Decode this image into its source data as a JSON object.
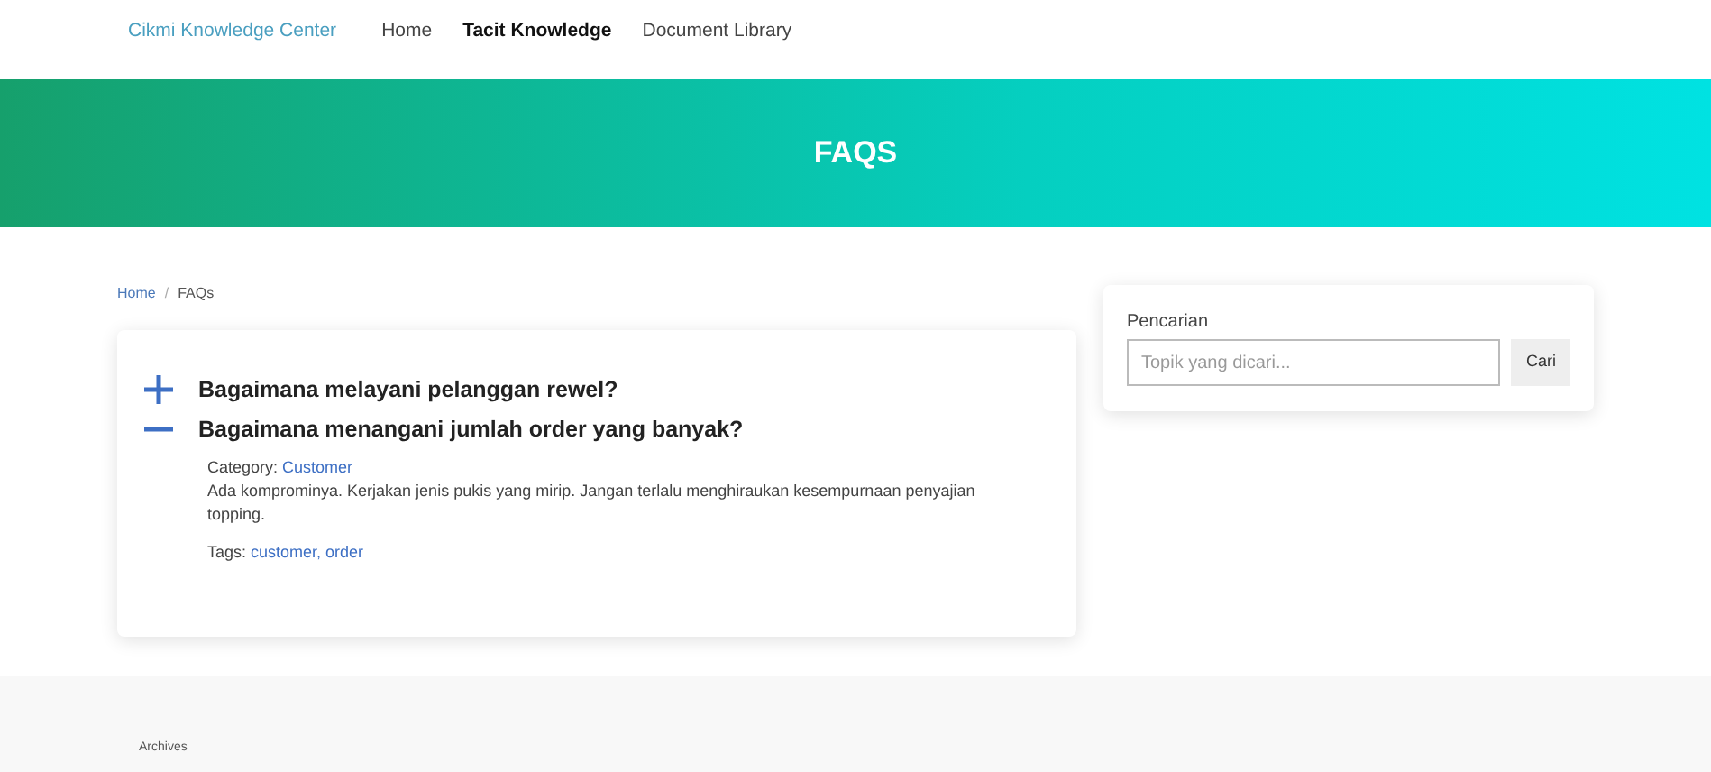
{
  "nav": {
    "brand": "Cikmi Knowledge Center",
    "links": [
      {
        "label": "Home",
        "selected": false
      },
      {
        "label": "Tacit Knowledge",
        "selected": true
      },
      {
        "label": "Document Library",
        "selected": false
      }
    ]
  },
  "hero": {
    "title": "FAQS"
  },
  "breadcrumb": [
    {
      "label": "Home",
      "kind": "link"
    },
    {
      "label": "/",
      "kind": "separator"
    },
    {
      "label": "FAQs",
      "kind": "current"
    }
  ],
  "faqs": [
    {
      "question": "Bagaimana melayani pelanggan rewel?",
      "expanded": false
    },
    {
      "question": "Bagaimana menangani jumlah order yang banyak?",
      "expanded": true,
      "category_label": "Category:",
      "category": "Customer",
      "answer": "Ada komprominya. Kerjakan jenis pukis yang mirip. Jangan terlalu menghiraukan kesempurnaan penyajian topping.",
      "tags_label": "Tags:",
      "tags": "customer, order"
    }
  ],
  "search": {
    "label": "Pencarian",
    "placeholder": "Topik yang dicari...",
    "button": "Cari"
  },
  "footer": {
    "heading": "Archives"
  }
}
